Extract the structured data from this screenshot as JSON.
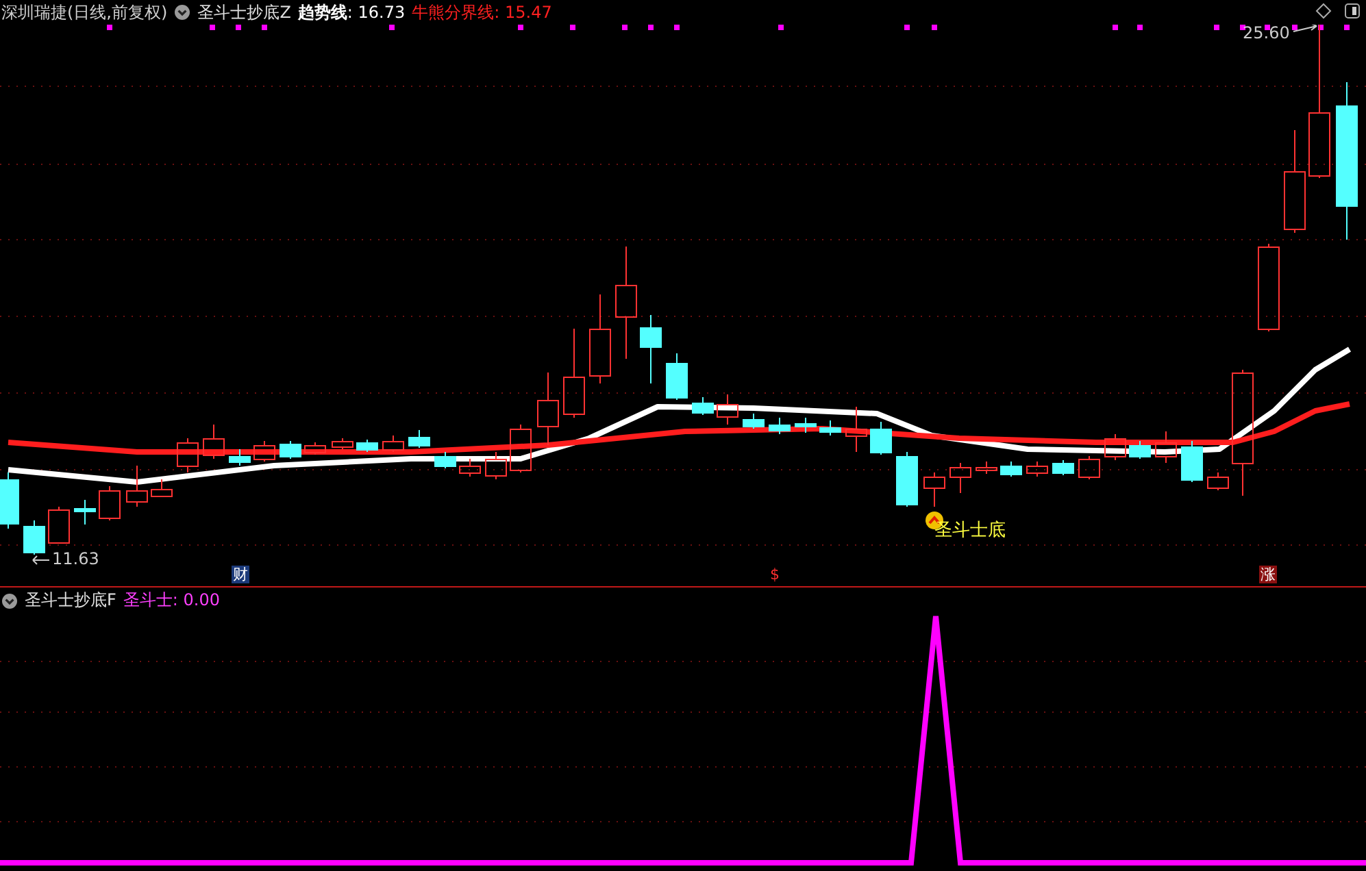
{
  "main_panel": {
    "title": "深圳瑞捷(日线,前复权)",
    "indicator_name": "圣斗士抄底Z",
    "trend_label": "**趋势线**: 16.73",
    "divider_label": "牛熊分界线: 15.47",
    "low_label": "11.63",
    "high_label": "25.60",
    "signal_label": "圣斗士底",
    "markers": [
      {
        "text": "财",
        "kind": "finance"
      },
      {
        "text": "$",
        "kind": "dividend"
      },
      {
        "text": "涨",
        "kind": "limit"
      }
    ]
  },
  "sub_panel": {
    "indicator_name": "圣斗士抄底F",
    "value_label": "圣斗士: 0.00"
  }
}
